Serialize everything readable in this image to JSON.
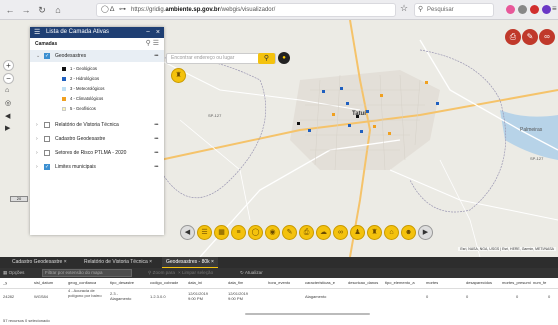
{
  "browser": {
    "url_prefix": "https://gridig.",
    "url_domain": "ambiente.sp.gov.br",
    "url_suffix": "/webgis/visualizador/",
    "search_placeholder": "Pesquisar",
    "back_icon": "arrow-left-icon",
    "forward_icon": "arrow-right-icon",
    "reload_icon": "reload-icon",
    "home_icon": "home-icon"
  },
  "map": {
    "search_placeholder": "Encontrar endereço ou lugar",
    "attribution": "Esri, NASA, NGA, USGS | Esri, HERE, Garmin, METI/NASA",
    "city_label": "Tatuí",
    "secondary_label": "Palmeiras",
    "road_labels": [
      "SP-127",
      "SP-127"
    ],
    "scale_label": "20",
    "toolbar_icons": [
      "layers-icon",
      "basemap-icon",
      "list-icon",
      "measure-icon",
      "location-icon",
      "draw-icon",
      "print-icon",
      "cloud-icon",
      "share-icon",
      "people-icon",
      "building-icon",
      "home-map-icon",
      "person-icon"
    ]
  },
  "layers_panel": {
    "title": "Lista de Camada Ativas",
    "section": "Camadas",
    "layers": [
      {
        "label": "Geodesastres",
        "checked": true,
        "expanded": true
      },
      {
        "label": "Relatório de Vistoria Técnica",
        "checked": false,
        "expanded": false
      },
      {
        "label": "Cadastro Geodesastre",
        "checked": false,
        "expanded": false
      },
      {
        "label": "Setores de Risco PTLMA - 2020",
        "checked": false,
        "expanded": false
      },
      {
        "label": "Limites municipais",
        "checked": true,
        "expanded": false
      }
    ],
    "legend": [
      {
        "label": "1 - Geológicos",
        "color": "#111111"
      },
      {
        "label": "2 - Hidrológicos",
        "color": "#1f5fbf"
      },
      {
        "label": "3 - Meteorológicos",
        "color": "#bfe0f5"
      },
      {
        "label": "4 - Climatológicos",
        "color": "#f0a020"
      },
      {
        "label": "5 - Geofísicos",
        "color": "#fff7b0"
      }
    ]
  },
  "bottom_tabs": [
    {
      "label": "Cadastro Geodesastre",
      "active": false
    },
    {
      "label": "Relatório de Vistoria Técnica",
      "active": false
    },
    {
      "label": "Geodesastres - 80k",
      "active": true
    }
  ],
  "attribute_toolbar": {
    "options": "Opções",
    "filter": "Filtrar por extensão do mapa",
    "zoom": "Zoom para",
    "clear": "Limpar seleção",
    "refresh": "Atualizar"
  },
  "table": {
    "columns": [
      "_y",
      "sisl_datum",
      "geog_confianca",
      "tipo_desastre",
      "codigo_cobrade",
      "data_ini",
      "data_fim",
      "hora_evento",
      "caracteristicas_e",
      "descricao_danos",
      "tipo_elemento_a",
      "mortes",
      "desaparecidos",
      "mortes_presumi",
      "num_fe"
    ],
    "rows": [
      [
        "24282",
        "WGS84",
        "4 - Acuracia de polígono por bairro",
        "2.3 - Alagamento",
        "1.2.3.0.0",
        "12/01/2019 9:00 PM",
        "12/01/2019 9:00 PM",
        "",
        "Alagamento",
        "",
        "",
        "0",
        "0",
        "0",
        "0"
      ]
    ]
  },
  "status": "57 recursos   0 selecionado",
  "colors": {
    "panel_header": "#1f3f73",
    "accent_yellow": "#f4c20d",
    "action_red": "#c0392b"
  }
}
